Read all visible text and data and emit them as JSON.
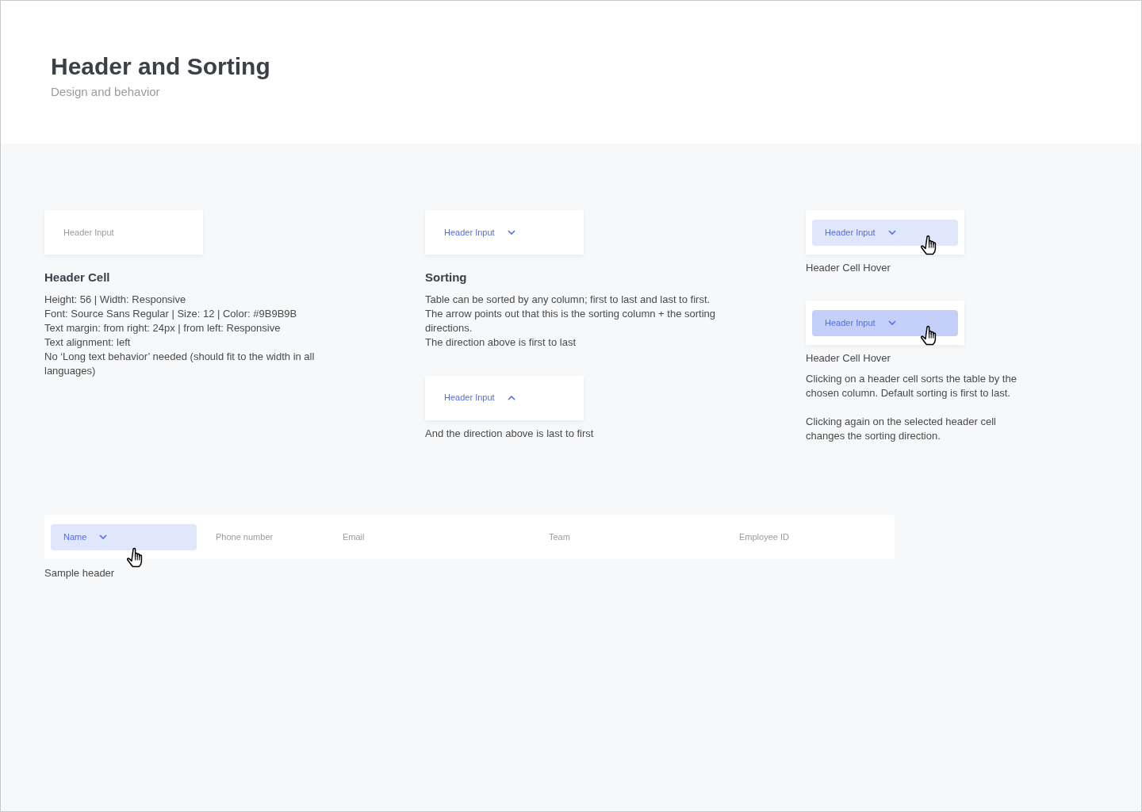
{
  "header": {
    "title": "Header and Sorting",
    "subtitle": "Design and behavior"
  },
  "columns": [
    {
      "blocks": [
        {
          "kind": "cell",
          "label": "Header Input",
          "selected": false,
          "hovered": false,
          "pressed": false,
          "sorted": false,
          "cursor": false
        },
        {
          "kind": "heading",
          "text": "Header Cell"
        },
        {
          "kind": "text",
          "lines": [
            "Height: 56 | Width: Responsive",
            "Font: Source Sans Regular | Size: 12 | Color: #9B9B9B",
            "Text margin: from right: 24px | from left: Responsive",
            "Text alignment: left",
            "No ‘Long text behavior’ needed (should fit to the width in all languages)"
          ]
        }
      ]
    },
    {
      "blocks": [
        {
          "kind": "cell",
          "label": "Header Input",
          "selected": true,
          "hovered": false,
          "pressed": false,
          "sorted": true,
          "reversed": false,
          "cursor": false
        },
        {
          "kind": "heading",
          "text": "Sorting"
        },
        {
          "kind": "text",
          "lines": [
            "Table can be sorted by any column; first to last and last to first.",
            "The arrow points out that this is the sorting column + the sorting directions.",
            "The direction above is first to last"
          ]
        },
        {
          "kind": "gap"
        },
        {
          "kind": "cell",
          "label": "Header Input",
          "selected": true,
          "hovered": false,
          "pressed": false,
          "sorted": true,
          "reversed": true,
          "cursor": false
        },
        {
          "kind": "caption",
          "text": "And the direction above is last to first"
        }
      ]
    },
    {
      "blocks": [
        {
          "kind": "cell",
          "label": "Header Input",
          "selected": true,
          "hovered": true,
          "pressed": false,
          "sorted": true,
          "reversed": false,
          "cursor": true
        },
        {
          "kind": "caption",
          "text": "Header Cell Hover"
        },
        {
          "kind": "gap"
        },
        {
          "kind": "cell",
          "label": "Header Input",
          "selected": true,
          "hovered": true,
          "pressed": true,
          "sorted": true,
          "reversed": false,
          "cursor": true
        },
        {
          "kind": "caption",
          "text": "Header Cell Hover"
        },
        {
          "kind": "text",
          "lines": [
            "Clicking on a header cell sorts the table by the chosen column. Default sorting is first to last."
          ]
        },
        {
          "kind": "text",
          "lines": [
            "Clicking again on the selected header cell changes the sorting direction."
          ]
        }
      ]
    }
  ],
  "sample_table": {
    "columns": [
      {
        "label": "Name",
        "selected": true,
        "sorted": true,
        "cursor": true
      },
      {
        "label": "Phone number",
        "selected": false,
        "sorted": false,
        "cursor": false
      },
      {
        "label": "Email",
        "selected": false,
        "sorted": false,
        "cursor": false
      },
      {
        "label": "Team",
        "selected": false,
        "sorted": false,
        "cursor": false
      },
      {
        "label": "Employee ID",
        "selected": false,
        "sorted": false,
        "cursor": false
      }
    ],
    "caption": "Sample header"
  }
}
